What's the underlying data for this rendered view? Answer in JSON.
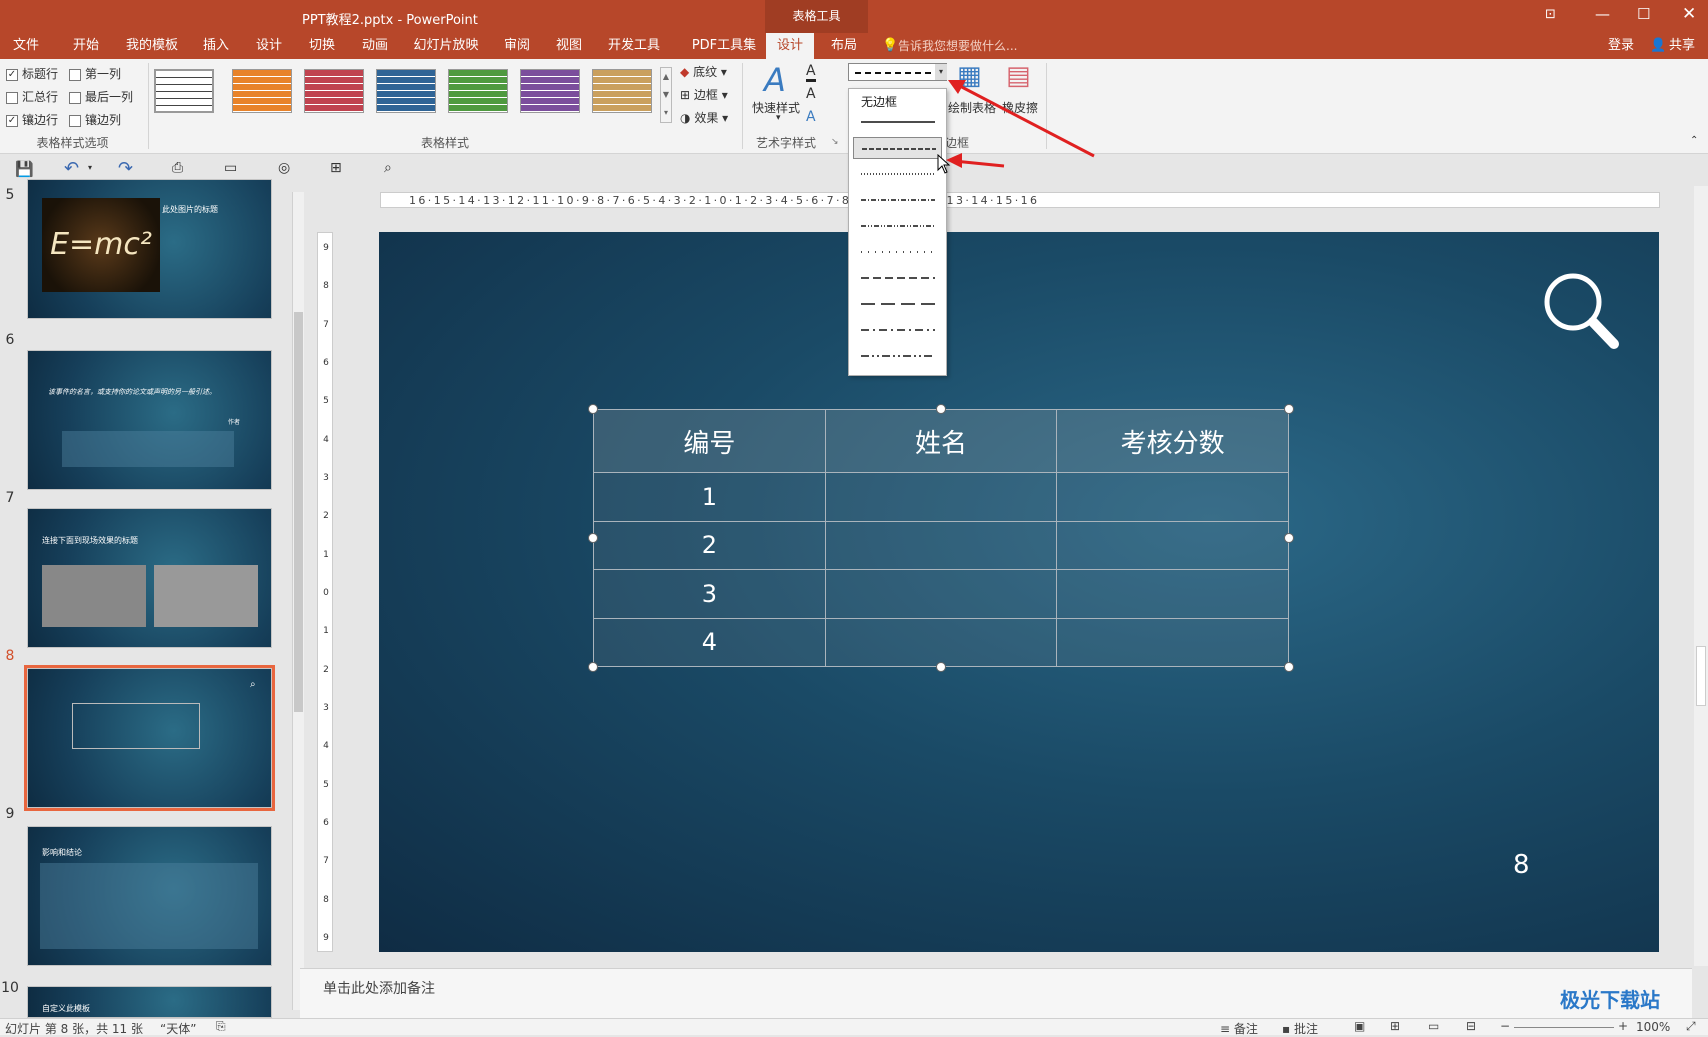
{
  "title_bar": {
    "doc_title": "PPT教程2.pptx - PowerPoint",
    "context_tool": "表格工具"
  },
  "tabs": [
    "文件",
    "开始",
    "我的模板",
    "插入",
    "设计",
    "切换",
    "动画",
    "幻灯片放映",
    "审阅",
    "视图",
    "开发工具",
    "PDF工具集",
    "设计",
    "布局"
  ],
  "active_tab_index": 12,
  "tell_me": "告诉我您想要做什么...",
  "login": "登录",
  "share": "共享",
  "ribbon": {
    "style_options": {
      "items": [
        {
          "label": "标题行",
          "checked": true
        },
        {
          "label": "第一列",
          "checked": false
        },
        {
          "label": "汇总行",
          "checked": false
        },
        {
          "label": "最后一列",
          "checked": false
        },
        {
          "label": "镶边行",
          "checked": true
        },
        {
          "label": "镶边列",
          "checked": false
        }
      ],
      "group_label": "表格样式选项"
    },
    "table_styles": {
      "group_label": "表格样式",
      "swatch_colors": [
        "#ffffff",
        "#e8832a",
        "#c0434f",
        "#2f6496",
        "#4f9a3f",
        "#7b4e9c",
        "#caa05e"
      ],
      "shading": "底纹",
      "borders": "边框",
      "effects": "效果"
    },
    "art_styles": {
      "group_label": "艺术字样式",
      "quick_styles": "快速样式"
    },
    "draw_borders": {
      "group_label": "边框",
      "draw_table": "绘制表格",
      "eraser": "橡皮擦"
    }
  },
  "dropdown": {
    "no_border": "无边框",
    "selected_index": 1,
    "styles": [
      "solid",
      "dash",
      "dot",
      "dash-dot",
      "dash-dot-dot",
      "spaced-dot",
      "long-dash",
      "long-dash-long",
      "long-dash-dot",
      "long-dash-dot-dot"
    ]
  },
  "thumbnails": [
    {
      "num": "5",
      "title": "此处图片的标题",
      "formula": "E=mc²"
    },
    {
      "num": "6",
      "quote": "该事件的名言，或支持你的论文或声明的另一般引述。",
      "author": "作者"
    },
    {
      "num": "7",
      "title": "连接下面到现场效果的标题"
    },
    {
      "num": "8",
      "selected": true
    },
    {
      "num": "9",
      "title": "影响和结论"
    },
    {
      "num": "10",
      "title": "自定义此模板"
    }
  ],
  "ruler": {
    "h": "16·15·14·13·12·11·10·9·8·7·6·5·4·3·2·1·0·1·2·3·4·5·6·7·8·9·10·11·12·13·14·15·16",
    "v": [
      "9",
      "8",
      "7",
      "6",
      "5",
      "4",
      "3",
      "2",
      "1",
      "0",
      "1",
      "2",
      "3",
      "4",
      "5",
      "6",
      "7",
      "8",
      "9"
    ]
  },
  "table": {
    "headers": [
      "编号",
      "姓名",
      "考核分数"
    ],
    "rows": [
      [
        "1",
        "",
        ""
      ],
      [
        "2",
        "",
        ""
      ],
      [
        "3",
        "",
        ""
      ],
      [
        "4",
        "",
        ""
      ]
    ]
  },
  "slide_number": "8",
  "notes_placeholder": "单击此处添加备注",
  "status": {
    "slide_info": "幻灯片 第 8 张，共 11 张",
    "theme": "“天体”",
    "notes": "备注",
    "comments": "批注",
    "zoom": "100%"
  },
  "watermark": "极光下载站"
}
